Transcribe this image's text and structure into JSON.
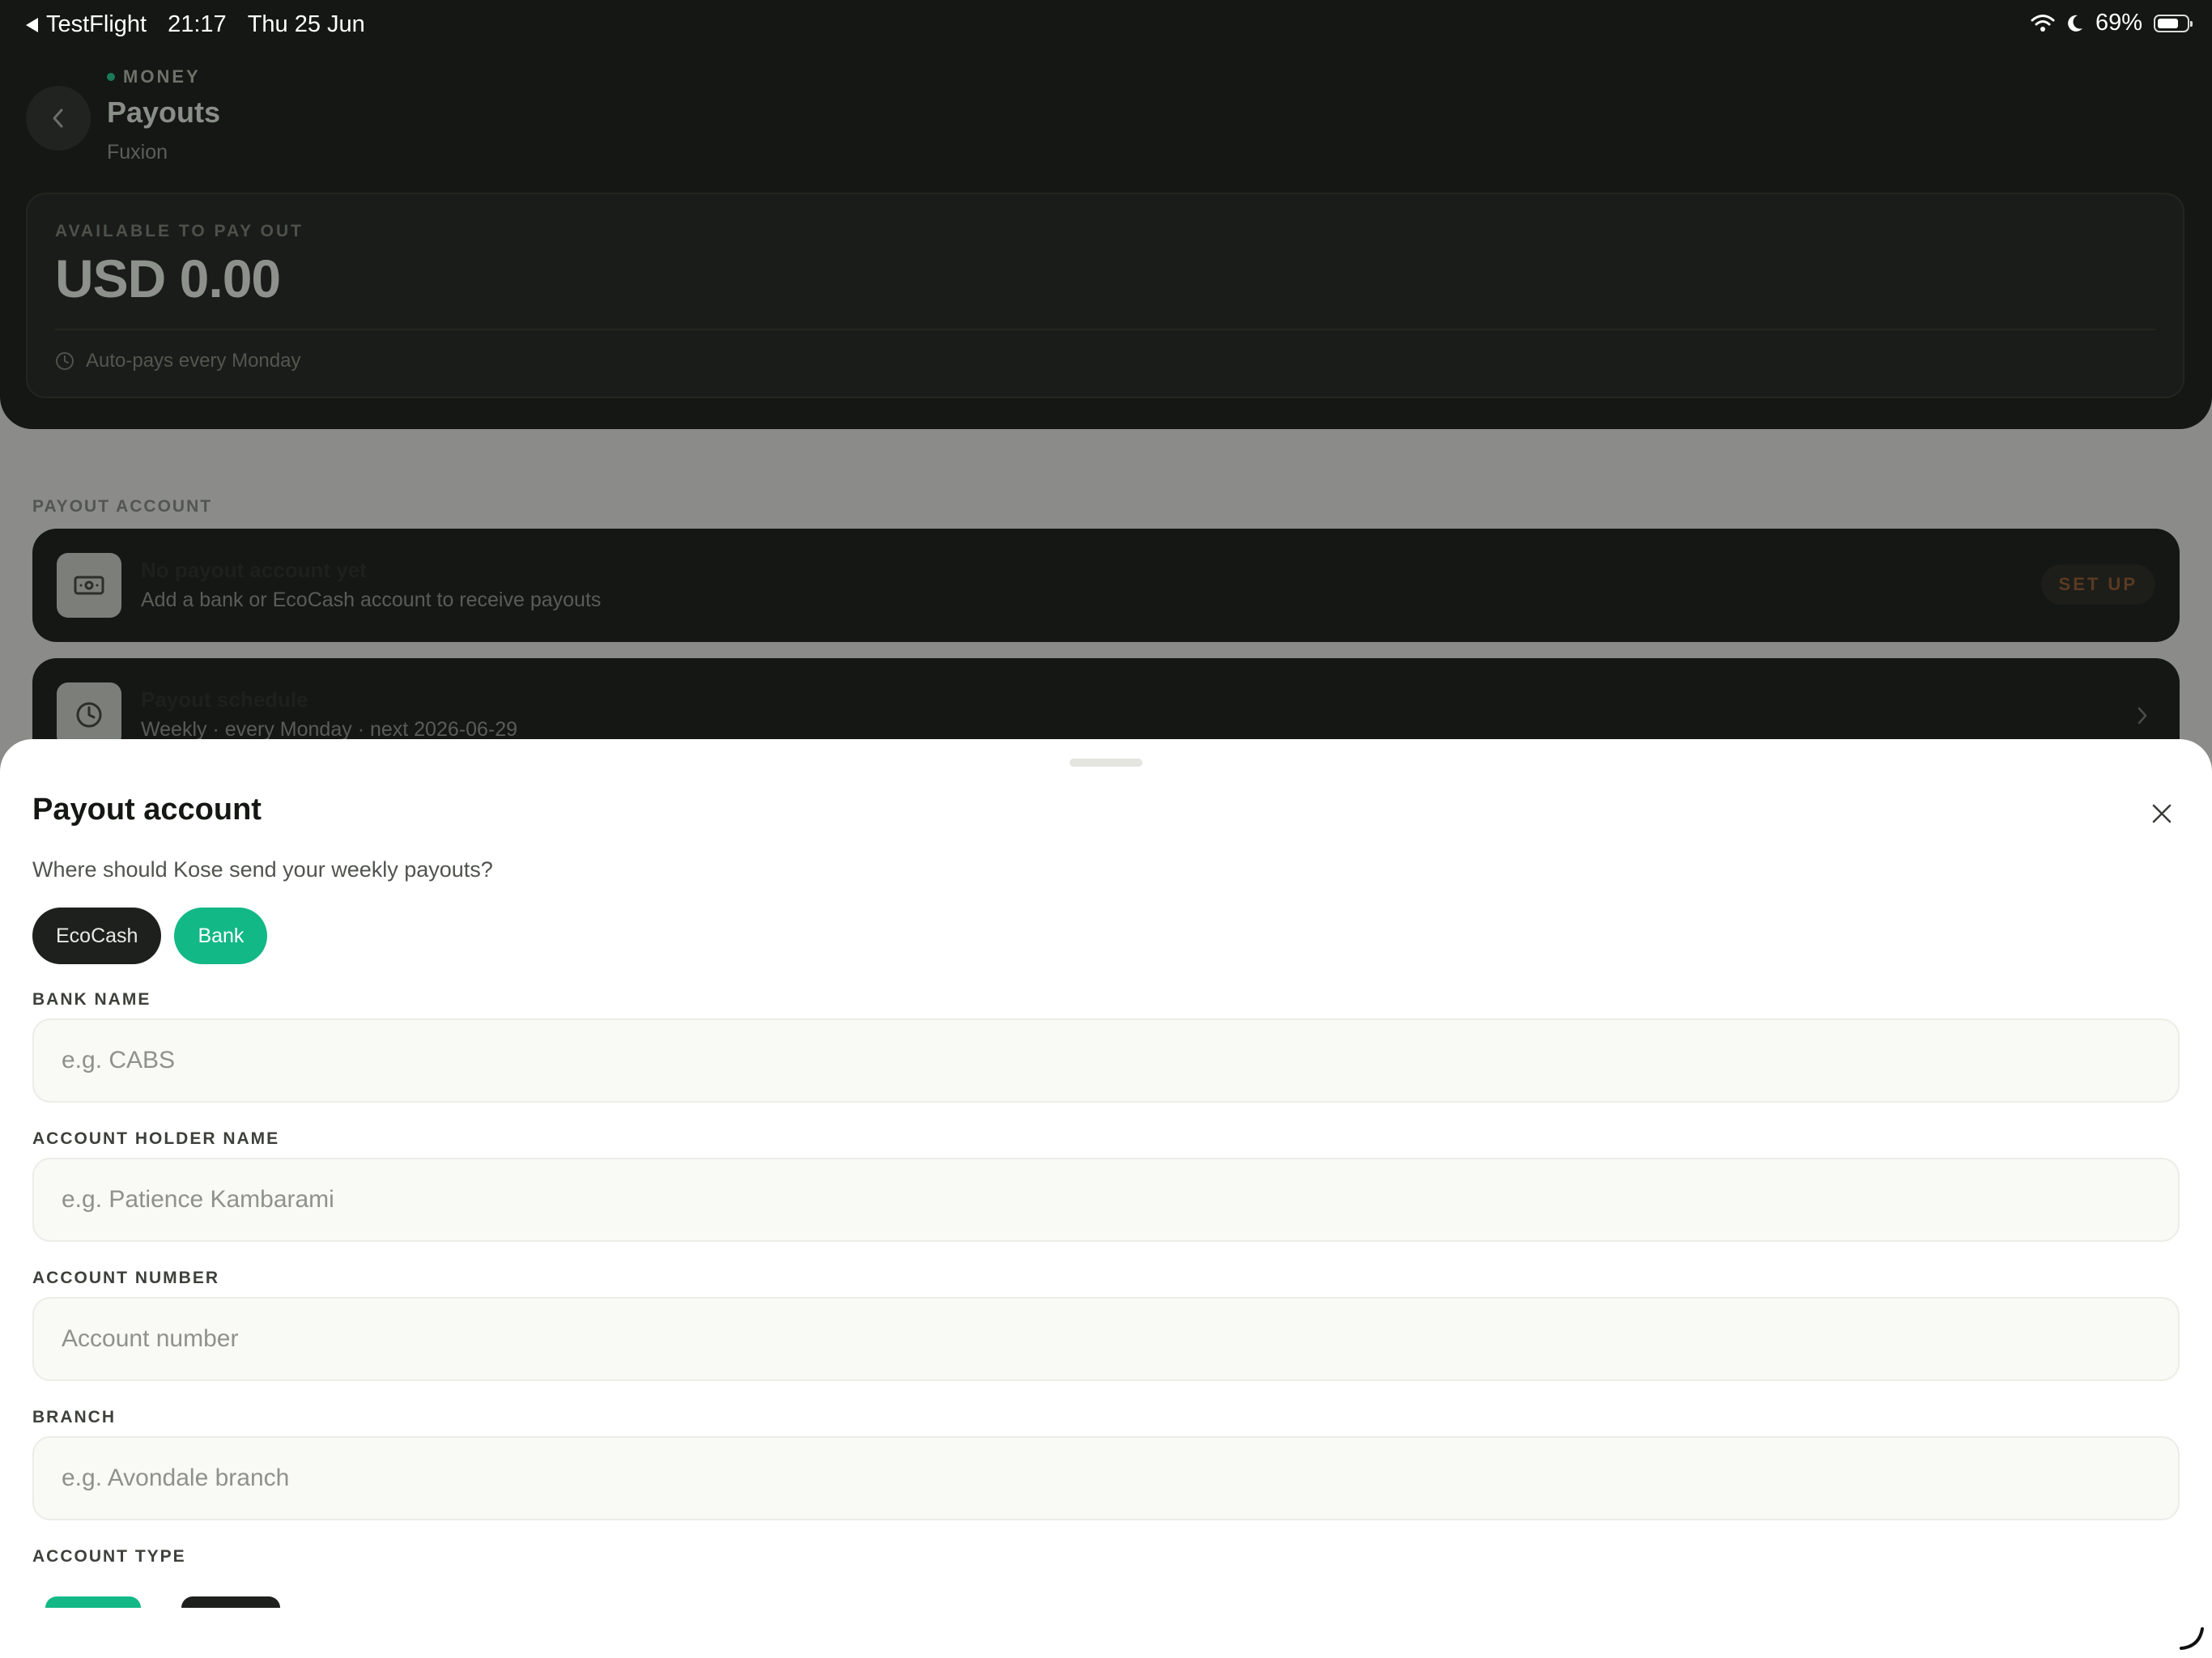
{
  "status_bar": {
    "back_app": "TestFlight",
    "time": "21:17",
    "date": "Thu 25 Jun",
    "battery": "69%",
    "battery_level": 0.69
  },
  "header": {
    "kicker": "MONEY",
    "title": "Payouts",
    "subtitle": "Fuxion"
  },
  "balance": {
    "label": "AVAILABLE TO PAY OUT",
    "amount": "USD 0.00",
    "schedule_note": "Auto-pays every Monday"
  },
  "payout_section": {
    "label": "PAYOUT ACCOUNT",
    "account_card": {
      "title": "No payout account yet",
      "subtitle": "Add a bank or EcoCash account to receive payouts",
      "action": "SET UP"
    },
    "schedule_card": {
      "title": "Payout schedule",
      "subtitle": "Weekly · every Monday · next 2026-06-29"
    }
  },
  "sheet": {
    "title": "Payout account",
    "subtitle": "Where should Kose send your weekly payouts?",
    "methods": [
      {
        "label": "EcoCash",
        "selected": false
      },
      {
        "label": "Bank",
        "selected": true
      }
    ],
    "fields": {
      "bank_name": {
        "label": "BANK NAME",
        "value": "",
        "placeholder": "e.g. CABS"
      },
      "holder_name": {
        "label": "ACCOUNT HOLDER NAME",
        "value": "",
        "placeholder": "e.g. Patience Kambarami"
      },
      "account_number": {
        "label": "ACCOUNT NUMBER",
        "value": "",
        "placeholder": "Account number"
      },
      "branch": {
        "label": "BRANCH",
        "value": "",
        "placeholder": "e.g. Avondale branch"
      }
    },
    "account_type_label": "ACCOUNT TYPE"
  },
  "colors": {
    "accent_green": "#12b886",
    "dark": "#141713",
    "setup_orange": "#c2691e"
  }
}
